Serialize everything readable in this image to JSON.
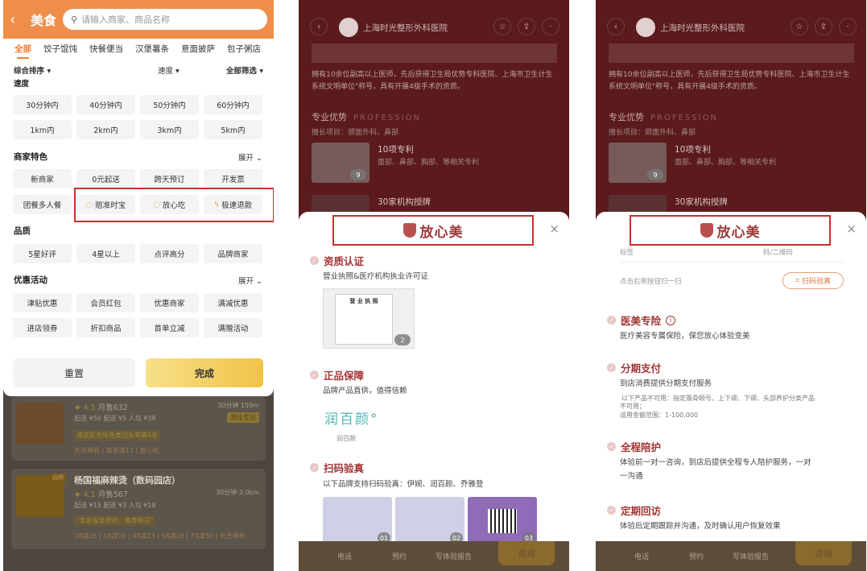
{
  "panel1": {
    "header": {
      "back": "‹",
      "title": "美食",
      "search_placeholder": "请输入商家、商品名称"
    },
    "cat_tabs": [
      "全部",
      "饺子馄饨",
      "快餐便当",
      "汉堡薯条",
      "意面披萨",
      "包子粥店"
    ],
    "sort": {
      "overall": "综合排序",
      "speed": "速度",
      "filter": "全部筛选"
    },
    "speed_label": "速度",
    "speed_chips": [
      "30分钟内",
      "40分钟内",
      "50分钟内",
      "60分钟内",
      "1km内",
      "2km内",
      "3km内",
      "5km内"
    ],
    "feature_title": "商家特色",
    "expand": "展开",
    "feature_chips": [
      "新商家",
      "0元起送",
      "跨天预订",
      "开发票",
      "团餐多人餐",
      "赔准时宝",
      "放心吃",
      "极速退款"
    ],
    "quality_title": "品质",
    "quality_chips": [
      "5星好评",
      "4星以上",
      "点评高分",
      "品牌商家"
    ],
    "promo_title": "优惠活动",
    "promo_chips": [
      "津贴优惠",
      "会员红包",
      "优惠商家",
      "满减优惠",
      "进店领券",
      "折扣商品",
      "首单立减",
      "满赠活动"
    ],
    "reset": "重置",
    "done": "完成",
    "shop1": {
      "rating": "★ 4.5",
      "sales": "月售632",
      "meta": "起送 ¥50  配送 ¥5  人均 ¥38",
      "time": "30分钟  159m",
      "tag": "满佳专送",
      "rank": "浦滨区金味熟食回头率第4名",
      "promos": "天天神券 | 首单减17 | 放心吃"
    },
    "shop2": {
      "name": "杨国福麻辣烫（数码园店）",
      "brand_badge": "品牌",
      "rating": "★ 4.1",
      "sales": "月售567",
      "meta": "起送 ¥15  配送 ¥3  人均 ¥18",
      "time": "30分钟  3.0km",
      "review": "\"卖家服务周到，推荐购买\"",
      "promos": "28减16 | 38减19 | 48减23 | 58减26 | 79减30 | 天天神券"
    }
  },
  "panel2": {
    "hospital": "上海时光整形外科医院",
    "intro": "拥有10余位副高以上医师，先后获得卫生局优势专科医院、上海市卫生计生系统文明单位\"称号，具有开展4级手术的资质。",
    "adv_title": "专业优势",
    "adv_en": "PROFESSION",
    "adv_sub": "擅长项目：颌面外科、鼻部",
    "item1_title": "10项专利",
    "item1_sub": "面部、鼻部、胸部、等相关专利",
    "item1_count": "9",
    "item2_title": "30家机构授牌",
    "brand": "放心美",
    "close": "×",
    "f1_title": "资质认证",
    "f1_desc": "营业执照&医疗机构执业许可证",
    "license_title": "营 业 执 照",
    "license_count": "2",
    "f2_title": "正品保障",
    "f2_desc": "品牌产品直供，值得信赖",
    "rb_logo": "润百颜°",
    "rb_label": "润百颜",
    "f3_title": "扫码验真",
    "f3_desc": "以下品牌支持扫码验真：伊婉、润百颜、乔雅登",
    "img_nums": [
      "01",
      "02",
      "03"
    ],
    "bottom": {
      "phone": "电话",
      "book": "预约",
      "report": "写体验报告",
      "cta": "咨询"
    }
  },
  "panel3": {
    "hospital": "上海时光整形外科医院",
    "intro": "拥有10余位副高以上医师，先后获得卫生局优势专科医院、上海市卫生计生系统文明单位\"称号，具有开展4级手术的资质。",
    "adv_title": "专业优势",
    "adv_en": "PROFESSION",
    "adv_sub": "擅长项目：颌面外科、鼻部",
    "item1_title": "10项专利",
    "item1_sub": "面部、鼻部、胸部、等相关专利",
    "item1_count": "9",
    "item2_title": "30家机构授牌",
    "brand": "放心美",
    "close": "×",
    "label_left": "标签",
    "label_right": "码/二维码",
    "scan_hint": "点击右侧按钮扫一扫",
    "scan_btn": "扫码验真",
    "f1_title": "医美专险",
    "f1_info": "i",
    "f1_desc": "医疗美容专属保险，保您放心体验变美",
    "f2_title": "分期支付",
    "f2_desc": "到店消费提供分期支付服务",
    "f2_note1": "以下产品不可用：指定翡骨颐号、上下颌、下颌、头部养护分类产品",
    "f2_note2": "不可用；",
    "f2_note3": "适用金额范围：1-100,000",
    "f3_title": "全程陪护",
    "f3_desc1": "体验前一对一咨询，到店后提供全程专人陪护服务，一对",
    "f3_desc2": "一沟通",
    "f4_title": "定期回访",
    "f4_desc": "体验后定期跟踪并沟通，及时确认用户恢复效果",
    "bottom": {
      "phone": "电话",
      "book": "预约",
      "report": "写体验报告",
      "cta": "咨询"
    }
  }
}
